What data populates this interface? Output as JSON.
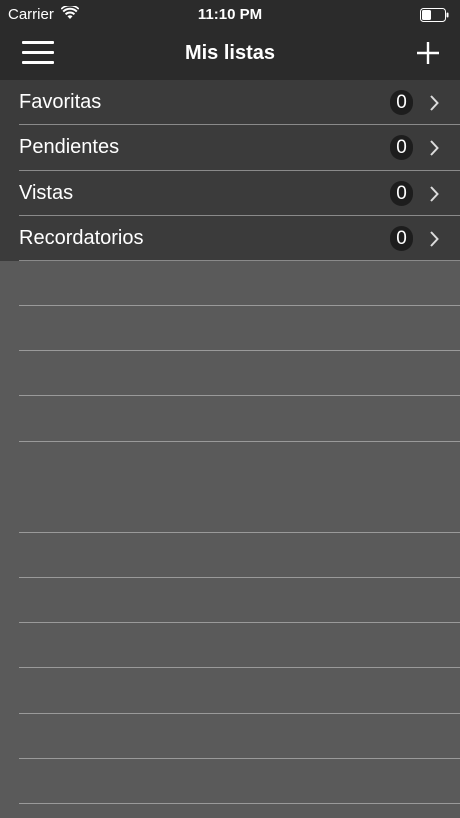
{
  "status_bar": {
    "carrier": "Carrier",
    "time": "11:10 PM",
    "icons": [
      "wifi-icon",
      "battery-icon"
    ]
  },
  "nav": {
    "title": "Mis listas",
    "left_icon": "menu-icon",
    "right_icon": "plus-icon"
  },
  "lists": [
    {
      "label": "Favoritas",
      "count": "0"
    },
    {
      "label": "Pendientes",
      "count": "0"
    },
    {
      "label": "Vistas",
      "count": "0"
    },
    {
      "label": "Recordatorios",
      "count": "0"
    }
  ],
  "colors": {
    "bar_background": "#2b2b2b",
    "row_background": "#3b3b3b",
    "screen_background": "#5a5a5a",
    "badge_background": "#1d1d1d",
    "text": "#ffffff"
  }
}
